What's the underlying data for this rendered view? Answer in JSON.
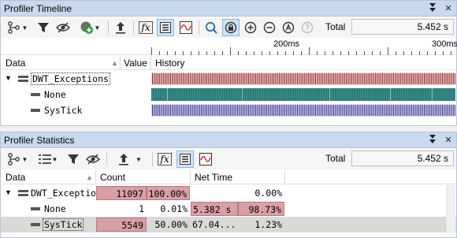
{
  "colors": {
    "titlebar": "#c9d9ee",
    "selected_button": "#cce4f7",
    "track_exceptions": "#8b1a1a",
    "track_none": "#2e7a7a",
    "track_systick": "#2d2d8a",
    "stat_bar": "#d8a0a4"
  },
  "timeline": {
    "title": "Profiler Timeline",
    "title_buttons": [
      "pin-icon",
      "close-icon"
    ],
    "toolbar_icons": [
      "tree-icon",
      "filter-icon",
      "hide-icon",
      "add-icon",
      "export-icon",
      "fx-icon",
      "list-icon",
      "wave-icon",
      "zoom-fit-icon",
      "zoom-selection-icon",
      "zoom-in-icon",
      "zoom-out-icon",
      "zoom-auto-icon",
      "zoom-disabled-icon"
    ],
    "total_label": "Total",
    "total_value": "5.452 s",
    "ruler_ticks": [
      "200ms",
      "300ms"
    ],
    "columns": {
      "data": "Data",
      "value": "Value",
      "history": "History"
    },
    "rows": [
      {
        "label": "DWT_Exceptions",
        "expanded": "▼",
        "value": ""
      },
      {
        "label": "None",
        "value": ""
      },
      {
        "label": "SysTick",
        "value": ""
      }
    ]
  },
  "stats": {
    "title": "Profiler Statistics",
    "title_buttons": [
      "pin-icon",
      "close-icon"
    ],
    "total_label": "Total",
    "total_value": "5.452 s",
    "columns": {
      "data": "Data",
      "count": "Count",
      "net_time": "Net Time"
    },
    "rows": [
      {
        "label": "DWT_Exceptio",
        "expanded": "▼",
        "count": "11097",
        "count_pct": "100.00%",
        "count_fraction": 1.0,
        "net_time": "",
        "net_pct": "0.00%",
        "net_fraction": 0.0
      },
      {
        "label": "None",
        "count": "1",
        "count_pct": "0.01%",
        "count_fraction": 0.0001,
        "net_time": "5.382 s",
        "net_pct": "98.73%",
        "net_fraction": 0.9873
      },
      {
        "label": "SysTick",
        "count": "5549",
        "count_pct": "50.00%",
        "count_fraction": 0.5,
        "net_time": "67.04...",
        "net_pct": "1.23%",
        "net_fraction": 0.0123
      }
    ]
  }
}
